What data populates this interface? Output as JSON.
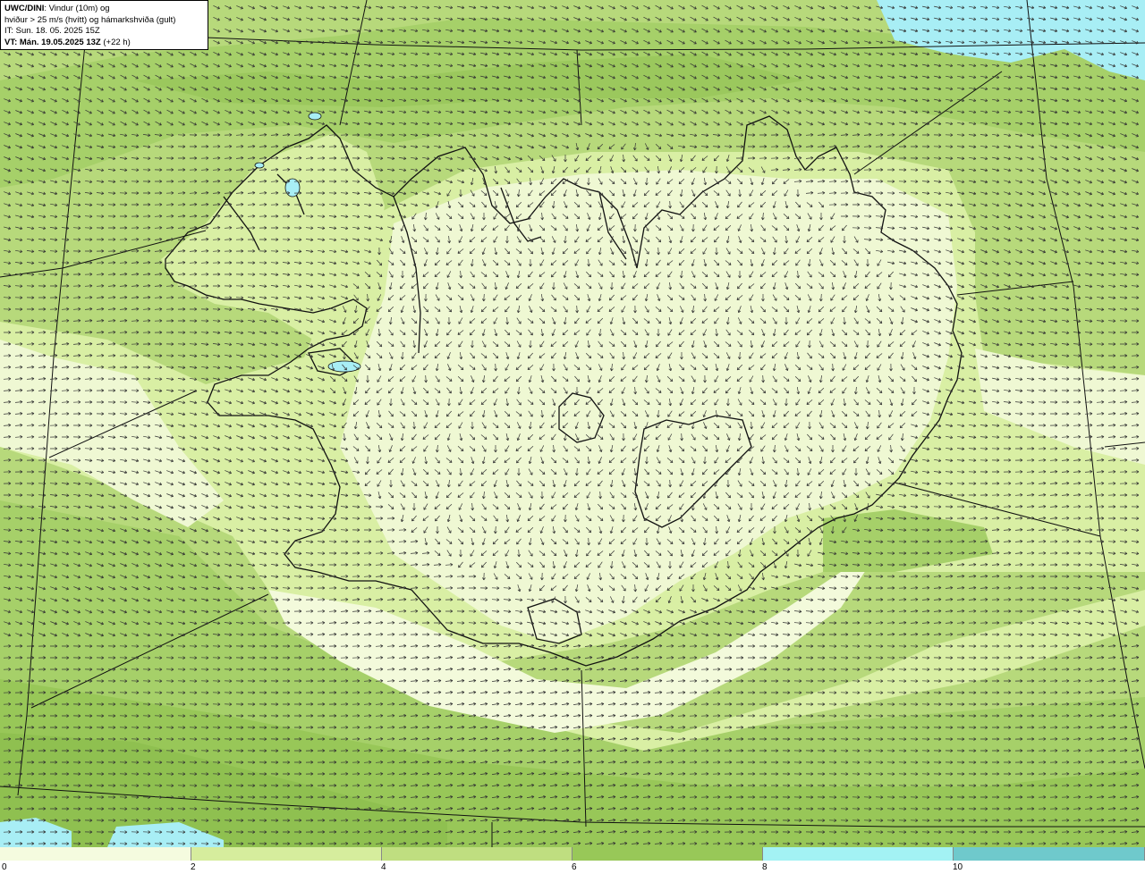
{
  "header": {
    "model": "UWC/DINI",
    "line1_rest": ": Vindur (10m) og",
    "line2": "hviður > 25 m/s (hvítt) og hámarkshviða (gult)",
    "line3": "IT: Sun. 18. 05. 2025 15Z",
    "vt_label": "VT: Mán. 19.05.2025 13Z",
    "vt_lead": " (+22 h)"
  },
  "legend": {
    "ticks": [
      "0",
      "2",
      "4",
      "6",
      "8",
      "10"
    ],
    "colors": [
      "#f5fbdf",
      "#d6ed9d",
      "#bfde80",
      "#98c858",
      "#a3f2f4",
      "#6fc9cc"
    ]
  },
  "palette": {
    "lightest": "#f3fadb",
    "light": "#d9efa4",
    "mid": "#bcdc80",
    "dark": "#9ccb5e",
    "darkest": "#86bb48",
    "cyan": "#a8eef5",
    "arrow": "#333333",
    "coast": "#111111"
  }
}
